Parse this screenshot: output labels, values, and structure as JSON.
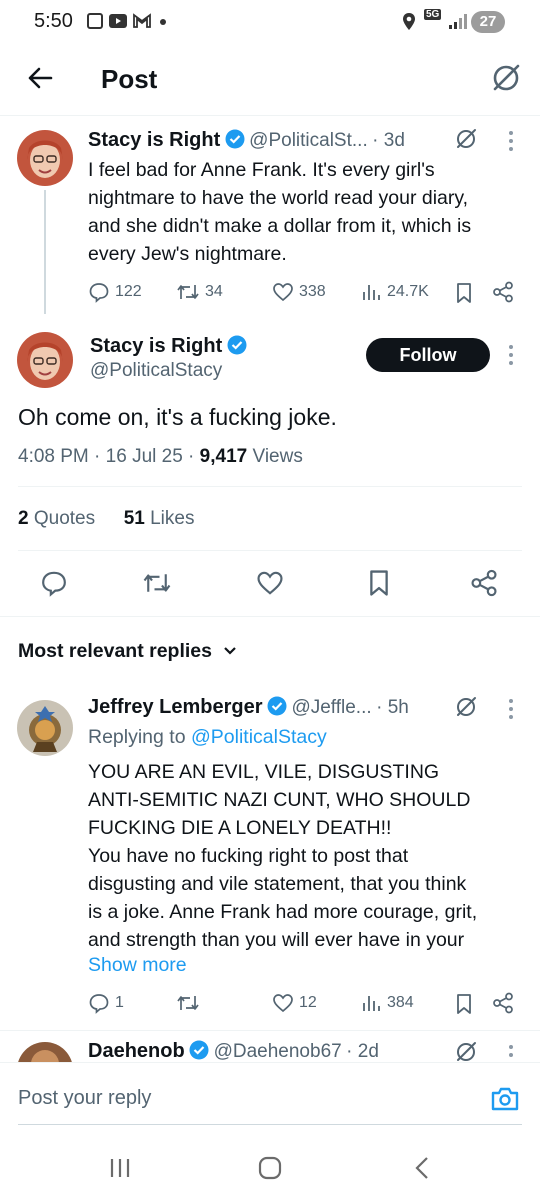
{
  "status_bar": {
    "time": "5:50",
    "network": "5G",
    "battery": "27"
  },
  "header": {
    "title": "Post"
  },
  "parent_post": {
    "author_name": "Stacy is Right",
    "handle": "@PoliticalSt...",
    "time_ago": "3d",
    "text_lines": [
      "I feel bad for Anne Frank. It's every girl's",
      "nightmare to have the world read your diary,",
      "and she didn't make a dollar from it, which is",
      "every Jew's nightmare."
    ],
    "replies": "122",
    "reposts": "34",
    "likes": "338",
    "views": "24.7K"
  },
  "main_post": {
    "author_name": "Stacy is Right",
    "handle": "@PoliticalStacy",
    "follow_label": "Follow",
    "text": "Oh come on, it's a fucking joke.",
    "time": "4:08 PM",
    "date": "16 Jul 25",
    "views_count": "9,417",
    "views_label": "Views",
    "quotes_count": "2",
    "quotes_label": "Quotes",
    "likes_count": "51",
    "likes_label": "Likes"
  },
  "replies_section": {
    "sort_label": "Most relevant replies"
  },
  "reply_1": {
    "author_name": "Jeffrey Lemberger",
    "handle": "@Jeffle...",
    "time_ago": "5h",
    "replying_to_label": "Replying to",
    "replying_to_handle": "@PoliticalStacy",
    "text_lines": [
      "YOU ARE AN EVIL, VILE, DISGUSTING",
      "ANTI-SEMITIC NAZI CUNT, WHO SHOULD",
      "FUCKING DIE A LONELY DEATH!!",
      "You have no fucking right to post that",
      "disgusting and vile statement, that you think",
      "is a joke. Anne Frank had more courage, grit,",
      "and strength than you will ever have in your"
    ],
    "show_more": "Show more",
    "replies": "1",
    "likes": "12",
    "views": "384"
  },
  "reply_2": {
    "author_name": "Daehenob",
    "handle": "@Daehenob67",
    "time_ago": "2d"
  },
  "composer": {
    "placeholder": "Post your reply"
  },
  "colors": {
    "accent": "#1d9bf0",
    "text": "#0f1419",
    "muted": "#536471"
  }
}
